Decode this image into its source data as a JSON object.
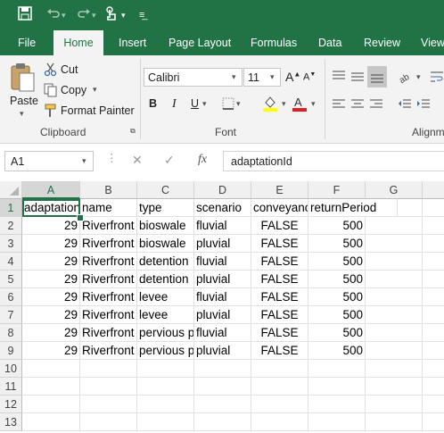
{
  "qat": {
    "save_icon": "save-icon",
    "undo_icon": "undo-icon",
    "redo_icon": "redo-icon",
    "touch_icon": "touch-mode-icon",
    "customize_icon": "customize-icon"
  },
  "tabs": [
    {
      "label": "File"
    },
    {
      "label": "Home"
    },
    {
      "label": "Insert"
    },
    {
      "label": "Page Layout"
    },
    {
      "label": "Formulas"
    },
    {
      "label": "Data"
    },
    {
      "label": "Review"
    },
    {
      "label": "View"
    }
  ],
  "clipboard": {
    "paste": "Paste",
    "cut": "Cut",
    "copy": "Copy",
    "format_painter": "Format Painter",
    "group": "Clipboard"
  },
  "font": {
    "name": "Calibri",
    "size": "11",
    "bold": "B",
    "italic": "I",
    "underline": "U",
    "group": "Font"
  },
  "alignment": {
    "group": "Alignm"
  },
  "formula_bar": {
    "name_box": "A1",
    "fx": "fx",
    "value": "adaptationId"
  },
  "sheet": {
    "columns": [
      "A",
      "B",
      "C",
      "D",
      "E",
      "F",
      "G"
    ],
    "rows": [
      "1",
      "2",
      "3",
      "4",
      "5",
      "6",
      "7",
      "8",
      "9",
      "10",
      "11",
      "12",
      "13"
    ],
    "header": [
      "adaptationId",
      "name",
      "type",
      "scenario",
      "conveyance",
      "returnPeriod"
    ],
    "data": [
      [
        "29",
        "Riverfront",
        "bioswale",
        "fluvial",
        "FALSE",
        "500"
      ],
      [
        "29",
        "Riverfront",
        "bioswale",
        "pluvial",
        "FALSE",
        "500"
      ],
      [
        "29",
        "Riverfront",
        "detention",
        "fluvial",
        "FALSE",
        "500"
      ],
      [
        "29",
        "Riverfront",
        "detention",
        "pluvial",
        "FALSE",
        "500"
      ],
      [
        "29",
        "Riverfront",
        "levee",
        "fluvial",
        "FALSE",
        "500"
      ],
      [
        "29",
        "Riverfront",
        "levee",
        "pluvial",
        "FALSE",
        "500"
      ],
      [
        "29",
        "Riverfront",
        "pervious p",
        "fluvial",
        "FALSE",
        "500"
      ],
      [
        "29",
        "Riverfront",
        "pervious p",
        "pluvial",
        "FALSE",
        "500"
      ]
    ]
  }
}
